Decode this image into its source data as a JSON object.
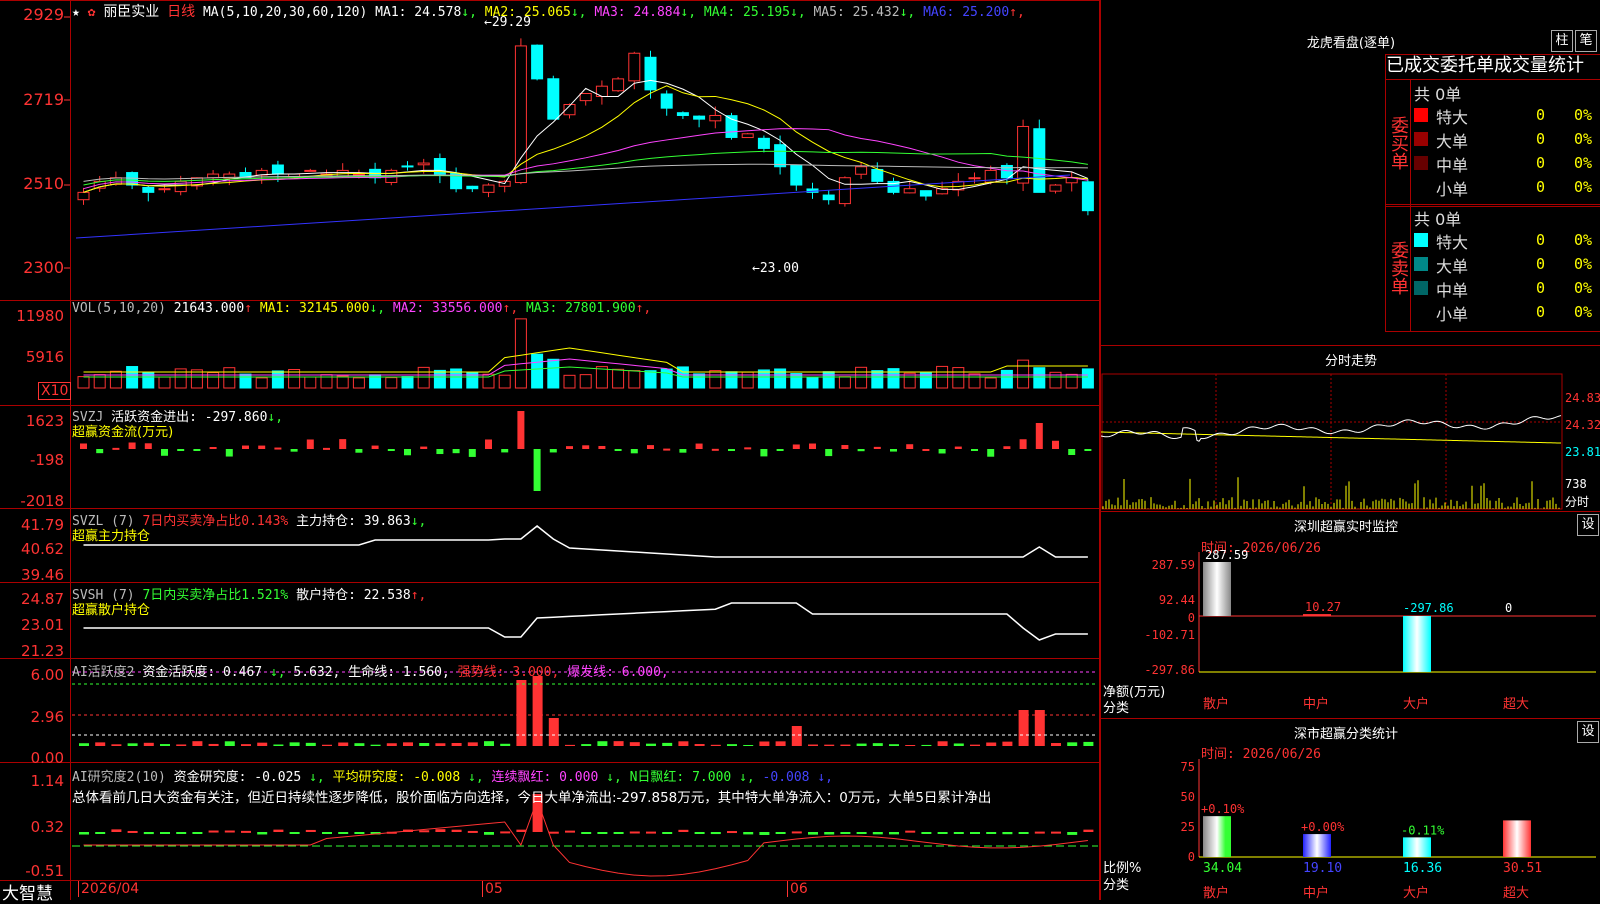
{
  "stock": {
    "name": "丽臣实业",
    "period": "日线",
    "star": "★",
    "marker": "✿"
  },
  "main": {
    "ma_params": "MA(5,10,20,30,60,120)",
    "ma": [
      {
        "label": "MA1:",
        "value": "24.578",
        "arrow": "↓",
        "color": "#ffffff"
      },
      {
        "label": "MA2:",
        "value": "25.065",
        "arrow": "↓",
        "color": "#ffff00"
      },
      {
        "label": "MA3:",
        "value": "24.884",
        "arrow": "↓",
        "color": "#ff44ff"
      },
      {
        "label": "MA4:",
        "value": "25.195",
        "arrow": "↓",
        "color": "#33ff33"
      },
      {
        "label": "MA5:",
        "value": "25.432",
        "arrow": "↓",
        "color": "#bbbbbb"
      },
      {
        "label": "MA6:",
        "value": "25.200",
        "arrow": "↑",
        "color": "#4444ff"
      }
    ],
    "y_ticks": [
      "2929",
      "2719",
      "2510",
      "2300"
    ],
    "high_label": "29.29",
    "low_label": "23.00"
  },
  "vol": {
    "params": "VOL(5,10,20)",
    "value": "21643.000",
    "value_arrow": "↑",
    "ma": [
      {
        "label": "MA1:",
        "value": "32145.000",
        "arrow": "↓",
        "color": "#ffff00"
      },
      {
        "label": "MA2:",
        "value": "33556.000",
        "arrow": "↑",
        "color": "#ff44ff"
      },
      {
        "label": "MA3:",
        "value": "27801.900",
        "arrow": "↑",
        "color": "#33ff33"
      }
    ],
    "y_ticks": [
      "11980",
      "5916"
    ],
    "unit": "X10"
  },
  "svzj": {
    "name": "SVZJ",
    "label": "活跃资金进出:",
    "value": "-297.860",
    "arrow": "↓,",
    "subtitle": "超赢资金流(万元)",
    "y_ticks": [
      "1623",
      "-198",
      "-2018"
    ]
  },
  "svzl": {
    "name": "SVZL (7)",
    "ratio": "7日内买卖净占比0.143%",
    "label": "主力持仓:",
    "value": "39.863",
    "arrow": "↓,",
    "subtitle": "超赢主力持仓",
    "y_ticks": [
      "41.79",
      "40.62",
      "39.46"
    ]
  },
  "svsh": {
    "name": "SVSH (7)",
    "ratio": "7日内买卖净占比1.521%",
    "label": "散户持仓:",
    "value": "22.538",
    "arrow": "↑,",
    "subtitle": "超赢散户持仓",
    "y_ticks": [
      "24.87",
      "23.01",
      "21.23"
    ]
  },
  "ai_act": {
    "name": "AI活跃度2",
    "items": [
      {
        "text": "资金活跃度:",
        "color": "#ffffff"
      },
      {
        "text": "0.467",
        "color": "#ffffff"
      },
      {
        "text": "↓,",
        "color": "#33ff33"
      },
      {
        "text": "5.632,",
        "color": "#ffffff"
      },
      {
        "text": "生命线:",
        "color": "#ffffff"
      },
      {
        "text": "1.560,",
        "color": "#ffffff"
      },
      {
        "text": "强势线:",
        "color": "#ff3333"
      },
      {
        "text": "3.000,",
        "color": "#ff3333"
      },
      {
        "text": "爆发线:",
        "color": "#ff44ff"
      },
      {
        "text": "6.000,",
        "color": "#ff44ff"
      }
    ],
    "y_ticks": [
      "6.00",
      "2.96",
      "0.00"
    ]
  },
  "ai_res": {
    "name": "AI研究度2(10)",
    "items": [
      {
        "text": "资金研究度:",
        "color": "#ffffff"
      },
      {
        "text": "-0.025",
        "color": "#ffffff"
      },
      {
        "text": "↓,",
        "color": "#33ff33"
      },
      {
        "text": "平均研究度:",
        "color": "#ffff00"
      },
      {
        "text": "-0.008",
        "color": "#ffff00"
      },
      {
        "text": "↓,",
        "color": "#33ff33"
      },
      {
        "text": "连续飘红:",
        "color": "#ff44ff"
      },
      {
        "text": "0.000",
        "color": "#ff44ff"
      },
      {
        "text": "↓,",
        "color": "#33ff33"
      },
      {
        "text": "N日飘红:",
        "color": "#33ff33"
      },
      {
        "text": "7.000",
        "color": "#33ff33"
      },
      {
        "text": "↓,",
        "color": "#33ff33"
      },
      {
        "text": "-0.008",
        "color": "#4444ff"
      },
      {
        "text": "↓,",
        "color": "#4444ff"
      }
    ],
    "summary": "总体看前几日大资金有关注，但近日持续性逐步降低，股价面临方向选择，今日大单净流出:-297.858万元，其中特大单净流入：0万元，大单5日累计净出",
    "y_ticks": [
      "1.14",
      "0.32",
      "-0.51"
    ]
  },
  "footer": {
    "brand": "大智慧",
    "date_start": "2026/04",
    "m05": "05",
    "m06": "06"
  },
  "lhb": {
    "title": "龙虎看盘(逐单)",
    "btn1": "柱",
    "btn2": "笔",
    "tabs": [
      "已成交",
      "委托单",
      "成交量统计"
    ],
    "buy": {
      "side": "委买单",
      "total": "共 0单",
      "rows": [
        {
          "label": "特大",
          "count": "0",
          "pct": "0%",
          "color": "#ff0000"
        },
        {
          "label": "大单",
          "count": "0",
          "pct": "0%",
          "color": "#990000"
        },
        {
          "label": "中单",
          "count": "0",
          "pct": "0%",
          "color": "#660000"
        },
        {
          "label": "小单",
          "count": "0",
          "pct": "0%",
          "color": "#000000"
        }
      ]
    },
    "sell": {
      "side": "委卖单",
      "total": "共 0单",
      "rows": [
        {
          "label": "特大",
          "count": "0",
          "pct": "0%",
          "color": "#00ffff"
        },
        {
          "label": "大单",
          "count": "0",
          "pct": "0%",
          "color": "#008888"
        },
        {
          "label": "中单",
          "count": "0",
          "pct": "0%",
          "color": "#006666"
        },
        {
          "label": "小单",
          "count": "0",
          "pct": "0%",
          "color": "#000000"
        }
      ]
    }
  },
  "intraday": {
    "title": "分时走势",
    "y_ticks": [
      "24.83",
      "24.32",
      "23.81"
    ],
    "vol_label": "738",
    "unit": "分时"
  },
  "sz_monitor": {
    "title": "深圳超赢实时监控",
    "btn": "设",
    "time": "时间: 2026/06/26",
    "y_ticks": [
      "287.59",
      "92.44",
      "0",
      "-102.71",
      "-297.86"
    ],
    "axis_label": "净额(万元)",
    "cat_label": "分类",
    "bars": [
      {
        "name": "散户",
        "value": "287.59"
      },
      {
        "name": "中户",
        "value": "10.27"
      },
      {
        "name": "大户",
        "value": "-297.86"
      },
      {
        "name": "超大",
        "value": "0"
      }
    ]
  },
  "sz_stat": {
    "title": "深市超赢分类统计",
    "btn": "设",
    "time": "时间: 2026/06/26",
    "y_ticks": [
      "75",
      "50",
      "25",
      "0"
    ],
    "axis_label": "比例%",
    "cat_label": "分类",
    "bars": [
      {
        "name": "散户",
        "value": "34.04",
        "delta": "+0.10%"
      },
      {
        "name": "中户",
        "value": "19.10",
        "delta": "+0.00%"
      },
      {
        "name": "大户",
        "value": "16.36",
        "delta": "-0.11%"
      },
      {
        "name": "超大",
        "value": "30.51",
        "delta": ""
      }
    ]
  },
  "colors": {
    "up": "#ff3333",
    "down": "#00ffff",
    "grid": "#aa0000"
  }
}
